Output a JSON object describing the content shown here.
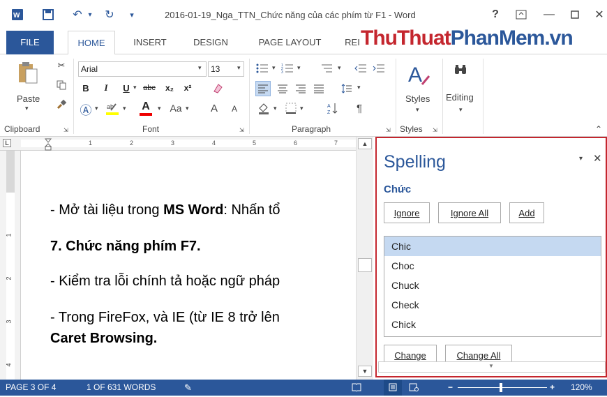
{
  "title_bar": {
    "doc_title": "2016-01-19_Nga_TTN_Chức năng của các phím từ F1 - Word",
    "help": "?"
  },
  "tabs": [
    {
      "label": "FILE"
    },
    {
      "label": "HOME"
    },
    {
      "label": "INSERT"
    },
    {
      "label": "DESIGN"
    },
    {
      "label": "PAGE LAYOUT"
    },
    {
      "label": "REI"
    }
  ],
  "watermark": {
    "part1": "ThuThuat",
    "part2": "PhanMem",
    "part3": ".vn",
    "c1": "#c4262e",
    "c2": "#2b579a"
  },
  "ribbon": {
    "clipboard": {
      "paste": "Paste",
      "label": "Clipboard"
    },
    "font": {
      "name": "Arial",
      "size": "13",
      "bold": "B",
      "italic": "I",
      "underline": "U",
      "strike": "abc",
      "sub": "x₂",
      "sup": "x²",
      "aa": "Aa",
      "grow": "A",
      "shrink": "A",
      "color_a": "A",
      "label": "Font"
    },
    "paragraph": {
      "label": "Paragraph",
      "pilcrow": "¶"
    },
    "styles": {
      "label": "Styles",
      "btn": "Styles"
    },
    "editing": {
      "btn": "Editing"
    }
  },
  "ruler": {
    "marks": [
      "1",
      "2",
      "3",
      "4",
      "5",
      "6",
      "7"
    ]
  },
  "vruler": {
    "marks": [
      "1",
      "2",
      "3",
      "4"
    ]
  },
  "document": {
    "line1_pre": "- Mở tài liệu trong ",
    "line1_bold": "MS Word",
    "line1_post": ": Nhấn tổ",
    "line2": "7. Chức năng phím F7.",
    "line3": "- Kiểm tra lỗi chính tả hoặc ngữ pháp",
    "line4": "- Trong FireFox, và IE (từ IE 8 trở lên",
    "line5": "Caret Browsing."
  },
  "spelling_pane": {
    "title": "Spelling",
    "word": "Chức",
    "ignore": "Ignore",
    "ignore_all": "Ignore All",
    "add": "Add",
    "suggestions": [
      "Chic",
      "Choc",
      "Chuck",
      "Check",
      "Chick"
    ],
    "change": "Change",
    "change_all": "Change All"
  },
  "status_bar": {
    "page": "PAGE 3 OF 4",
    "words": "1 OF 631 WORDS",
    "zoom": "120%"
  },
  "colors": {
    "accent": "#2b579a",
    "highlight": "#c4262e"
  }
}
